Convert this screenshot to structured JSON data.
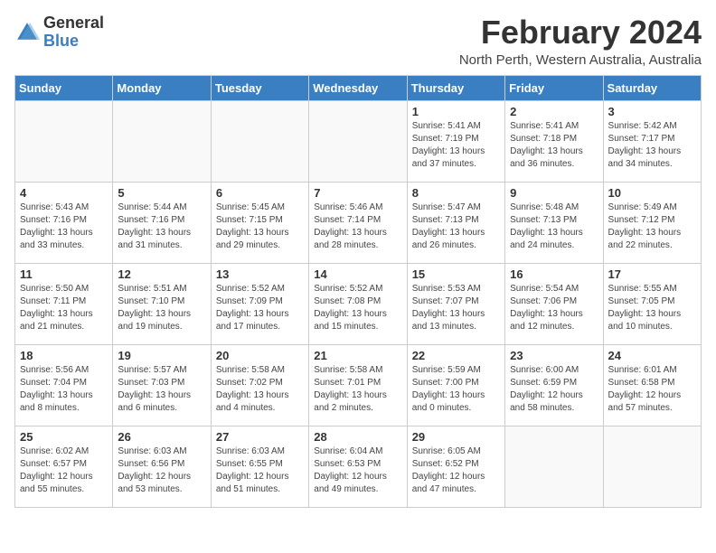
{
  "header": {
    "logo_general": "General",
    "logo_blue": "Blue",
    "month_year": "February 2024",
    "location": "North Perth, Western Australia, Australia"
  },
  "days_of_week": [
    "Sunday",
    "Monday",
    "Tuesday",
    "Wednesday",
    "Thursday",
    "Friday",
    "Saturday"
  ],
  "weeks": [
    [
      {
        "day": "",
        "info": ""
      },
      {
        "day": "",
        "info": ""
      },
      {
        "day": "",
        "info": ""
      },
      {
        "day": "",
        "info": ""
      },
      {
        "day": "1",
        "info": "Sunrise: 5:41 AM\nSunset: 7:19 PM\nDaylight: 13 hours\nand 37 minutes."
      },
      {
        "day": "2",
        "info": "Sunrise: 5:41 AM\nSunset: 7:18 PM\nDaylight: 13 hours\nand 36 minutes."
      },
      {
        "day": "3",
        "info": "Sunrise: 5:42 AM\nSunset: 7:17 PM\nDaylight: 13 hours\nand 34 minutes."
      }
    ],
    [
      {
        "day": "4",
        "info": "Sunrise: 5:43 AM\nSunset: 7:16 PM\nDaylight: 13 hours\nand 33 minutes."
      },
      {
        "day": "5",
        "info": "Sunrise: 5:44 AM\nSunset: 7:16 PM\nDaylight: 13 hours\nand 31 minutes."
      },
      {
        "day": "6",
        "info": "Sunrise: 5:45 AM\nSunset: 7:15 PM\nDaylight: 13 hours\nand 29 minutes."
      },
      {
        "day": "7",
        "info": "Sunrise: 5:46 AM\nSunset: 7:14 PM\nDaylight: 13 hours\nand 28 minutes."
      },
      {
        "day": "8",
        "info": "Sunrise: 5:47 AM\nSunset: 7:13 PM\nDaylight: 13 hours\nand 26 minutes."
      },
      {
        "day": "9",
        "info": "Sunrise: 5:48 AM\nSunset: 7:13 PM\nDaylight: 13 hours\nand 24 minutes."
      },
      {
        "day": "10",
        "info": "Sunrise: 5:49 AM\nSunset: 7:12 PM\nDaylight: 13 hours\nand 22 minutes."
      }
    ],
    [
      {
        "day": "11",
        "info": "Sunrise: 5:50 AM\nSunset: 7:11 PM\nDaylight: 13 hours\nand 21 minutes."
      },
      {
        "day": "12",
        "info": "Sunrise: 5:51 AM\nSunset: 7:10 PM\nDaylight: 13 hours\nand 19 minutes."
      },
      {
        "day": "13",
        "info": "Sunrise: 5:52 AM\nSunset: 7:09 PM\nDaylight: 13 hours\nand 17 minutes."
      },
      {
        "day": "14",
        "info": "Sunrise: 5:52 AM\nSunset: 7:08 PM\nDaylight: 13 hours\nand 15 minutes."
      },
      {
        "day": "15",
        "info": "Sunrise: 5:53 AM\nSunset: 7:07 PM\nDaylight: 13 hours\nand 13 minutes."
      },
      {
        "day": "16",
        "info": "Sunrise: 5:54 AM\nSunset: 7:06 PM\nDaylight: 13 hours\nand 12 minutes."
      },
      {
        "day": "17",
        "info": "Sunrise: 5:55 AM\nSunset: 7:05 PM\nDaylight: 13 hours\nand 10 minutes."
      }
    ],
    [
      {
        "day": "18",
        "info": "Sunrise: 5:56 AM\nSunset: 7:04 PM\nDaylight: 13 hours\nand 8 minutes."
      },
      {
        "day": "19",
        "info": "Sunrise: 5:57 AM\nSunset: 7:03 PM\nDaylight: 13 hours\nand 6 minutes."
      },
      {
        "day": "20",
        "info": "Sunrise: 5:58 AM\nSunset: 7:02 PM\nDaylight: 13 hours\nand 4 minutes."
      },
      {
        "day": "21",
        "info": "Sunrise: 5:58 AM\nSunset: 7:01 PM\nDaylight: 13 hours\nand 2 minutes."
      },
      {
        "day": "22",
        "info": "Sunrise: 5:59 AM\nSunset: 7:00 PM\nDaylight: 13 hours\nand 0 minutes."
      },
      {
        "day": "23",
        "info": "Sunrise: 6:00 AM\nSunset: 6:59 PM\nDaylight: 12 hours\nand 58 minutes."
      },
      {
        "day": "24",
        "info": "Sunrise: 6:01 AM\nSunset: 6:58 PM\nDaylight: 12 hours\nand 57 minutes."
      }
    ],
    [
      {
        "day": "25",
        "info": "Sunrise: 6:02 AM\nSunset: 6:57 PM\nDaylight: 12 hours\nand 55 minutes."
      },
      {
        "day": "26",
        "info": "Sunrise: 6:03 AM\nSunset: 6:56 PM\nDaylight: 12 hours\nand 53 minutes."
      },
      {
        "day": "27",
        "info": "Sunrise: 6:03 AM\nSunset: 6:55 PM\nDaylight: 12 hours\nand 51 minutes."
      },
      {
        "day": "28",
        "info": "Sunrise: 6:04 AM\nSunset: 6:53 PM\nDaylight: 12 hours\nand 49 minutes."
      },
      {
        "day": "29",
        "info": "Sunrise: 6:05 AM\nSunset: 6:52 PM\nDaylight: 12 hours\nand 47 minutes."
      },
      {
        "day": "",
        "info": ""
      },
      {
        "day": "",
        "info": ""
      }
    ]
  ]
}
